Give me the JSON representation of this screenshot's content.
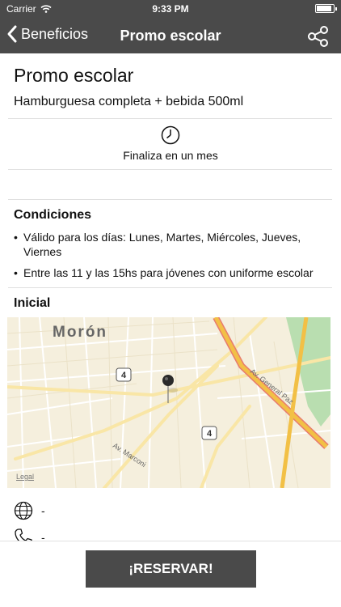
{
  "status_bar": {
    "carrier": "Carrier",
    "time": "9:33 PM"
  },
  "nav": {
    "back_label": "Beneficios",
    "title": "Promo escolar"
  },
  "promo": {
    "title": "Promo escolar",
    "description": "Hamburguesa completa + bebida 500ml",
    "ends_text": "Finaliza en un mes"
  },
  "conditions": {
    "heading": "Condiciones",
    "items": [
      "Válido para los días: Lunes, Martes, Miércoles, Jueves, Viernes",
      "Entre las 11 y las 15hs para jóvenes con uniforme escolar"
    ]
  },
  "location": {
    "heading": "Inicial",
    "map": {
      "city_label": "Morón",
      "route_4_a": "4",
      "route_4_b": "4",
      "avenue_marconi": "Av. Marconi",
      "avenue_general_paz": "Av. General Paz",
      "legal": "Legal"
    }
  },
  "contact": {
    "website": "-",
    "phone": "-"
  },
  "footer": {
    "reserve_label": "¡RESERVAR!"
  },
  "colors": {
    "bar": "#4a4a4a",
    "map_bg": "#f5efdd",
    "highway": "#f2c046",
    "highway_edge": "#e87c6e",
    "park": "#b9deb0"
  }
}
